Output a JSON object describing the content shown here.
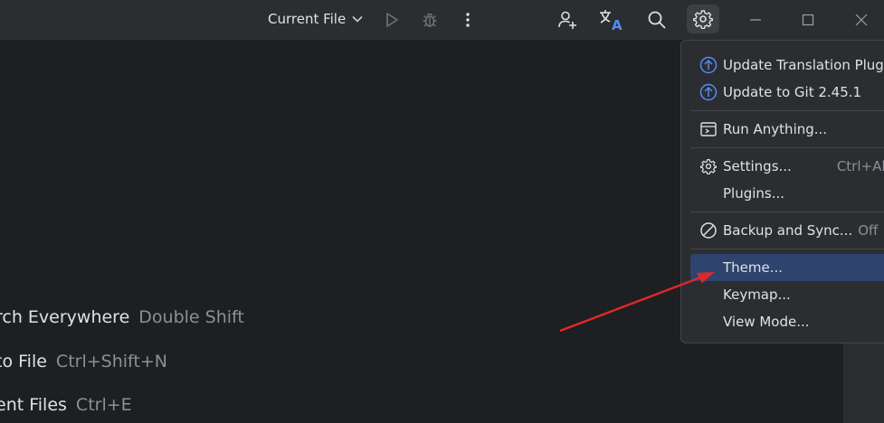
{
  "toolbar": {
    "run_config_label": "Current File",
    "icons": {
      "run": "play-icon",
      "debug": "bug-icon",
      "more": "more-vertical-icon",
      "add_user": "add-user-icon",
      "translate": "translate-icon",
      "search": "search-icon",
      "settings": "gear-icon"
    },
    "window": {
      "minimize": "minimize-icon",
      "maximize": "maximize-icon",
      "close": "close-icon"
    }
  },
  "editor": {
    "hints": [
      {
        "action": "rch Everywhere",
        "shortcut": "Double Shift"
      },
      {
        "action": "to File",
        "shortcut": "Ctrl+Shift+N"
      },
      {
        "action": "ent Files",
        "shortcut": "Ctrl+E"
      }
    ]
  },
  "menu": {
    "items": [
      {
        "label": "Update Translation Plugin",
        "icon": "update-arrow-icon",
        "shortcut": ""
      },
      {
        "label": "Update to Git 2.45.1",
        "icon": "update-arrow-icon",
        "shortcut": ""
      },
      {
        "label": "Run Anything...",
        "icon": "run-anything-icon",
        "shortcut": ""
      },
      {
        "label": "Settings...",
        "icon": "gear-icon",
        "shortcut": "Ctrl+Alt"
      },
      {
        "label": "Plugins...",
        "icon": "",
        "shortcut": ""
      },
      {
        "label": "Backup and Sync...",
        "icon": "disabled-circle-icon",
        "shortcut": "Off"
      },
      {
        "label": "Theme...",
        "icon": "",
        "shortcut": "",
        "selected": true
      },
      {
        "label": "Keymap...",
        "icon": "",
        "shortcut": ""
      },
      {
        "label": "View Mode...",
        "icon": "",
        "shortcut": ""
      }
    ]
  },
  "colors": {
    "background": "#1e1f22",
    "panel": "#2b2d30",
    "selection": "#2e436e",
    "update_accent": "#548af7",
    "annotation_arrow": "#e0282a"
  }
}
